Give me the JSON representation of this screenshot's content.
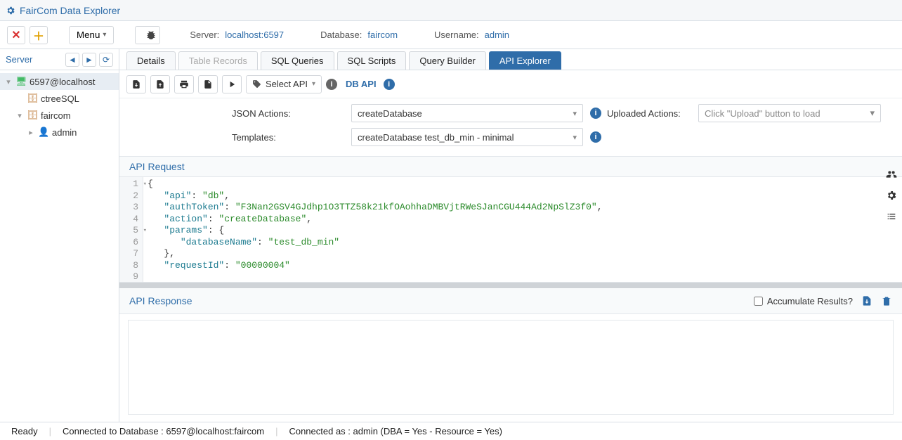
{
  "app": {
    "title": "FairCom Data Explorer"
  },
  "toolbar": {
    "menu_label": "Menu",
    "server_label": "Server:",
    "server_value": "localhost:6597",
    "database_label": "Database:",
    "database_value": "faircom",
    "username_label": "Username:",
    "username_value": "admin"
  },
  "sidebar": {
    "title": "Server",
    "nodes": {
      "root": "6597@localhost",
      "ctreesql": "ctreeSQL",
      "faircom": "faircom",
      "admin": "admin"
    }
  },
  "tabs": {
    "details": "Details",
    "table_records": "Table Records",
    "sql_queries": "SQL Queries",
    "sql_scripts": "SQL Scripts",
    "query_builder": "Query Builder",
    "api_explorer": "API Explorer"
  },
  "api_toolbar": {
    "select_api": "Select API",
    "db_api": "DB API"
  },
  "forms": {
    "json_actions_label": "JSON Actions:",
    "json_actions_value": "createDatabase",
    "templates_label": "Templates:",
    "templates_value": "createDatabase test_db_min - minimal",
    "uploaded_label": "Uploaded Actions:",
    "uploaded_placeholder": "Click \"Upload\" button to load"
  },
  "request": {
    "title": "API Request",
    "lines": [
      "1",
      "2",
      "3",
      "4",
      "5",
      "6",
      "7",
      "8",
      "9"
    ],
    "json": {
      "api": "db",
      "authToken": "F3Nan2GSV4GJdhp1O3TTZ58k21kfOAohhaDMBVjtRWeSJanCGU444Ad2NpSlZ3f0",
      "action": "createDatabase",
      "params": {
        "databaseName": "test_db_min"
      },
      "requestId": "00000004"
    }
  },
  "response": {
    "title": "API Response",
    "accumulate": "Accumulate Results?"
  },
  "status": {
    "ready": "Ready",
    "connected_db": "Connected to Database : 6597@localhost:faircom",
    "connected_as": "Connected as : admin (DBA = Yes - Resource = Yes)"
  }
}
